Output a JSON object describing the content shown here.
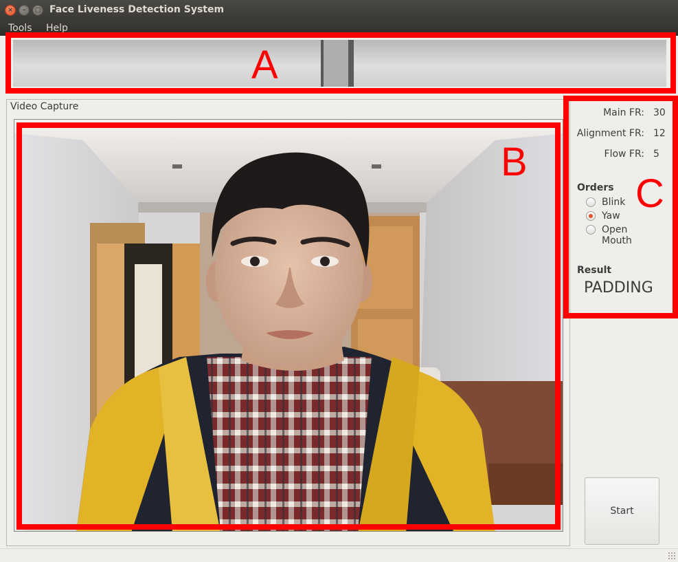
{
  "window": {
    "title": "Face Liveness Detection System",
    "buttons": [
      "close-icon",
      "minimize-icon",
      "maximize-icon"
    ]
  },
  "menubar": {
    "items": [
      "Tools",
      "Help"
    ]
  },
  "annotations": {
    "a": "A",
    "b": "B",
    "c": "C",
    "color": "#ff0000"
  },
  "video": {
    "group_title": "Video Capture"
  },
  "stats": {
    "main_label": "Main FR:",
    "main_value": "30",
    "alignment_label": "Alignment FR:",
    "alignment_value": "12",
    "flow_label": "Flow FR:",
    "flow_value": "5"
  },
  "orders": {
    "heading": "Orders",
    "options": [
      "Blink",
      "Yaw",
      "Open Mouth"
    ],
    "selected": "Yaw"
  },
  "result": {
    "heading": "Result",
    "value": "PADDING"
  },
  "controls": {
    "start_label": "Start"
  },
  "colors": {
    "titlebar": "#3c3b37",
    "accent": "#e0552c",
    "window_bg": "#efeeeb"
  }
}
